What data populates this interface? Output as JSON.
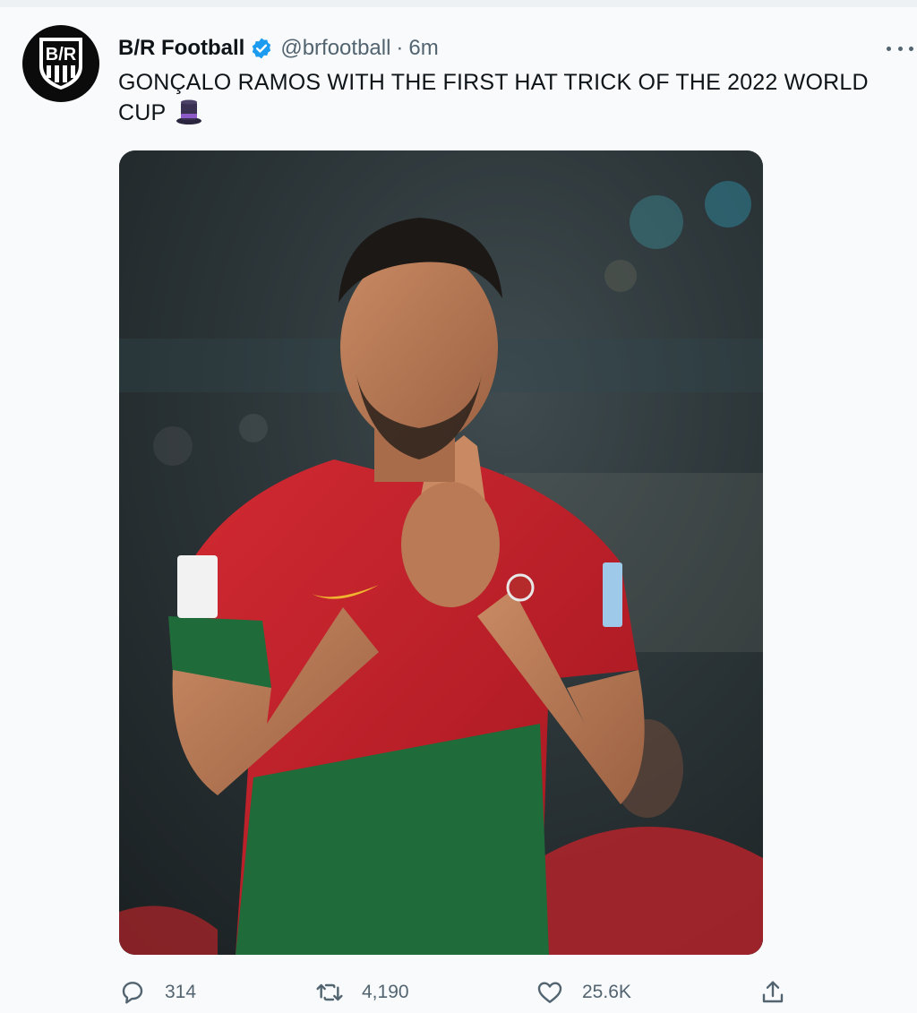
{
  "tweet": {
    "author": {
      "name": "B/R Football",
      "handle": "@brfootball",
      "separator": "·",
      "time": "6m",
      "verified_icon": "verified-badge-icon",
      "verified_color": "#1d9bf0",
      "avatar_label": "B/R"
    },
    "text": {
      "highlight": "GONÇALO RAMOS",
      "rest": " WITH THE FIRST HAT TRICK OF THE 2022 WORLD CUP",
      "emoji": "top-hat-icon"
    },
    "media": {
      "description": "photo-of-player-celebrating",
      "jersey_colors": [
        "#c8202b",
        "#1f6b3a"
      ]
    },
    "actions": {
      "replies": "314",
      "retweets": "4,190",
      "likes": "25.6K",
      "reply_icon": "reply-icon",
      "retweet_icon": "retweet-icon",
      "like_icon": "heart-icon",
      "share_icon": "share-icon"
    },
    "more_icon": "more-options-icon"
  },
  "colors": {
    "text_primary": "#0f1419",
    "text_secondary": "#536471",
    "background": "#f8fafb"
  }
}
